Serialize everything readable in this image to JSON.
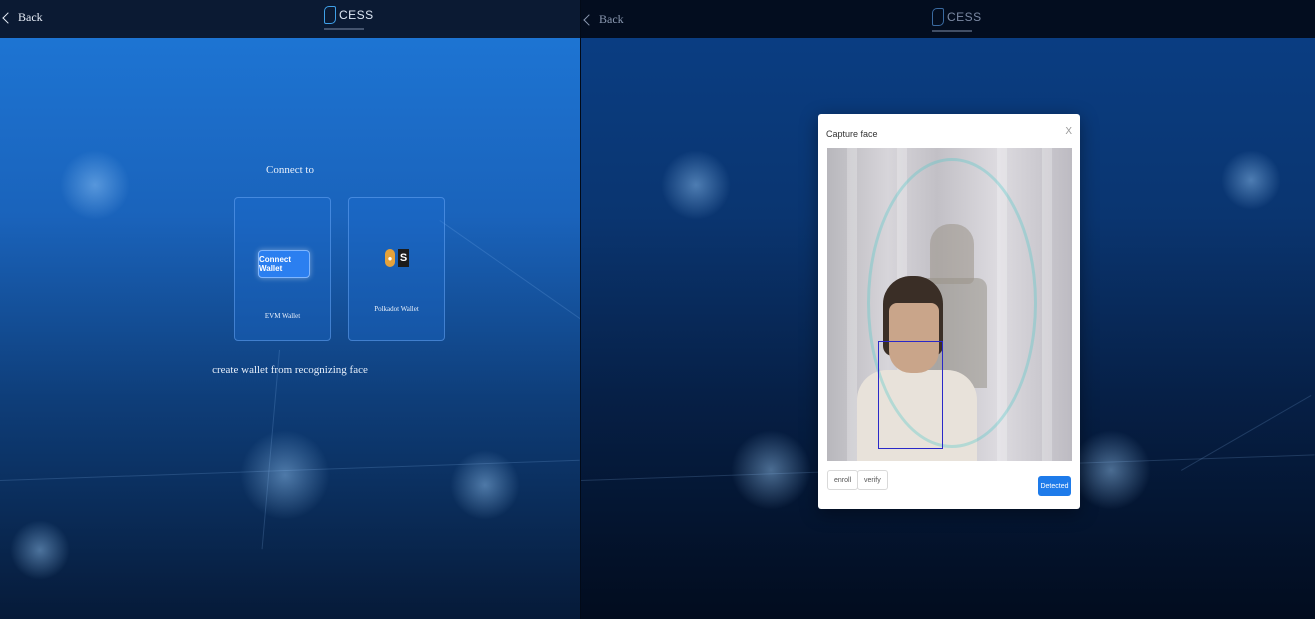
{
  "left_panel": {
    "header": {
      "back_label": "Back",
      "logo_text": "CESS"
    },
    "connect_title": "Connect to",
    "evm_card": {
      "button_label": "Connect Wallet",
      "label": "EVM Wallet"
    },
    "polkadot_card": {
      "label": "Polkadot Wallet",
      "icons": [
        "polkadot-icon",
        "subwallet-icon"
      ]
    },
    "face_link": "create wallet from recognizing face"
  },
  "right_panel": {
    "header": {
      "back_label": "Back",
      "logo_text": "CESS"
    },
    "modal": {
      "title": "Capture face",
      "close_label": "X",
      "enroll_label": "enroll",
      "verify_label": "verify",
      "detected_label": "Detected"
    }
  },
  "colors": {
    "accent": "#1e7bea",
    "face_box": "#2a28c8",
    "left_bg": "#1e78d8",
    "right_bg": "#0a3f86"
  }
}
